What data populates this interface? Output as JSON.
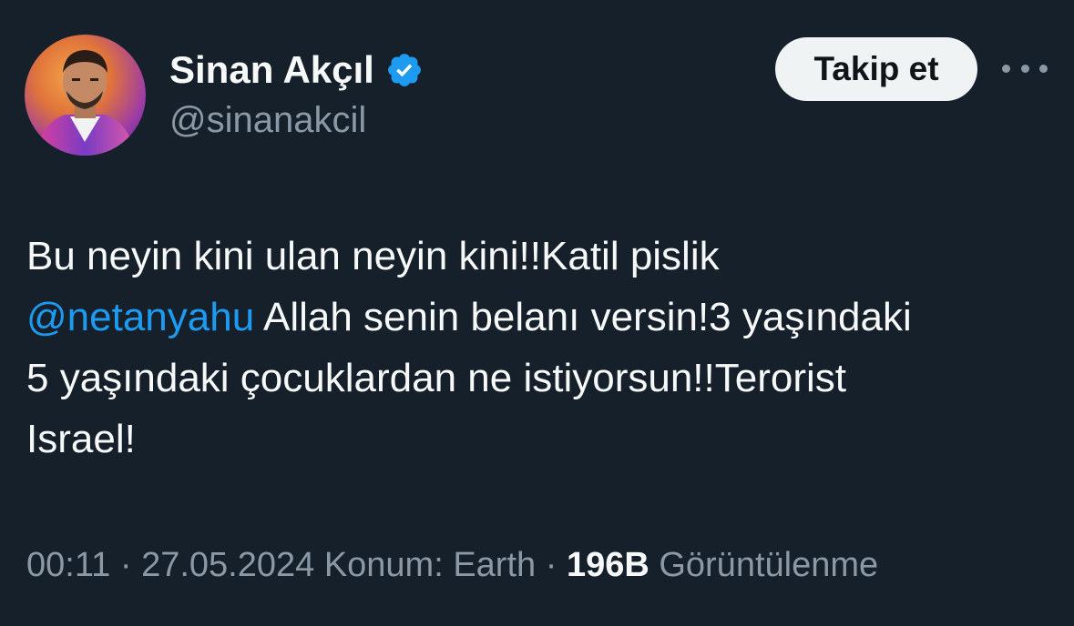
{
  "author": {
    "display_name": "Sinan Akçıl",
    "handle": "@sinanakcil",
    "verified": true
  },
  "follow_button": {
    "label": "Takip et"
  },
  "more_menu": {
    "icon": "more-horizontal-icon"
  },
  "tweet": {
    "line1": "Bu neyin kini ulan neyin kini!!Katil pislik",
    "mention": "@netanyahu",
    "line2_rest": " Allah senin belanı versin!3 yaşındaki",
    "line3": "5 yaşındaki çocuklardan ne istiyorsun!!Terorist",
    "line4": "Israel!"
  },
  "meta": {
    "time": "00:11",
    "date": "27.05.2024",
    "location": "Konum: Earth",
    "separator": " · ",
    "views_count": "196B",
    "views_label": " Görüntülenme"
  },
  "colors": {
    "background": "#15202b",
    "text": "#f7f9f9",
    "secondary": "#8b98a5",
    "accent": "#1d9bf0",
    "button_bg": "#eff3f4"
  }
}
